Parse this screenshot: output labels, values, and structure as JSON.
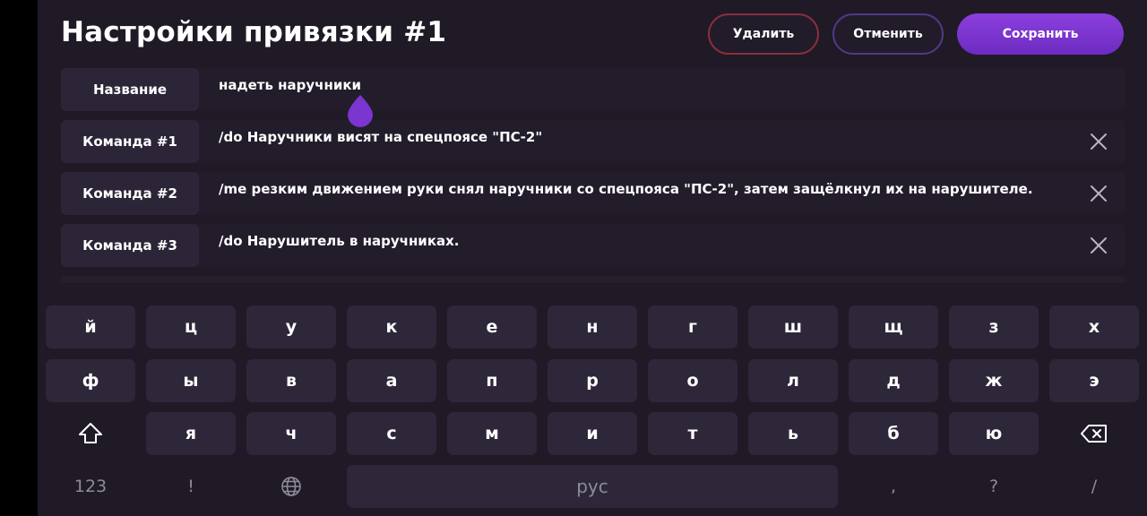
{
  "header": {
    "title": "Настройки привязки #1",
    "delete_label": "Удалить",
    "cancel_label": "Отменить",
    "save_label": "Сохранить"
  },
  "rows": [
    {
      "label": "Название",
      "value": "надеть наручники",
      "removable": false
    },
    {
      "label": "Команда #1",
      "value": "/do Наручники висят на спецпоясе \"ПС-2\"",
      "removable": true
    },
    {
      "label": "Команда #2",
      "value": "/me резким движением руки снял наручники со спецпояса \"ПС-2\", затем защёлкнул их на нарушителе.",
      "removable": true
    },
    {
      "label": "Команда #3",
      "value": "/do Нарушитель в наручниках.",
      "removable": true
    }
  ],
  "keyboard": {
    "row1": [
      "й",
      "ц",
      "у",
      "к",
      "е",
      "н",
      "г",
      "ш",
      "щ",
      "з",
      "х"
    ],
    "row2": [
      "ф",
      "ы",
      "в",
      "а",
      "п",
      "р",
      "о",
      "л",
      "д",
      "ж",
      "э"
    ],
    "row3": [
      "я",
      "ч",
      "с",
      "м",
      "и",
      "т",
      "ь",
      "б",
      "ю"
    ],
    "numbers_key": "123",
    "excl_key": "!",
    "space_label": "рус",
    "comma_key": ",",
    "question_key": "?",
    "slash_key": "/"
  },
  "icons": {
    "close": "close-icon",
    "shift": "shift-icon",
    "backspace": "backspace-icon",
    "globe": "globe-icon",
    "caret": "text-cursor-handle-icon"
  },
  "colors": {
    "background": "#1f1a26",
    "accent": "#7b35d0",
    "delete_border": "#8a2e3e",
    "cancel_border": "#4e3a86"
  }
}
